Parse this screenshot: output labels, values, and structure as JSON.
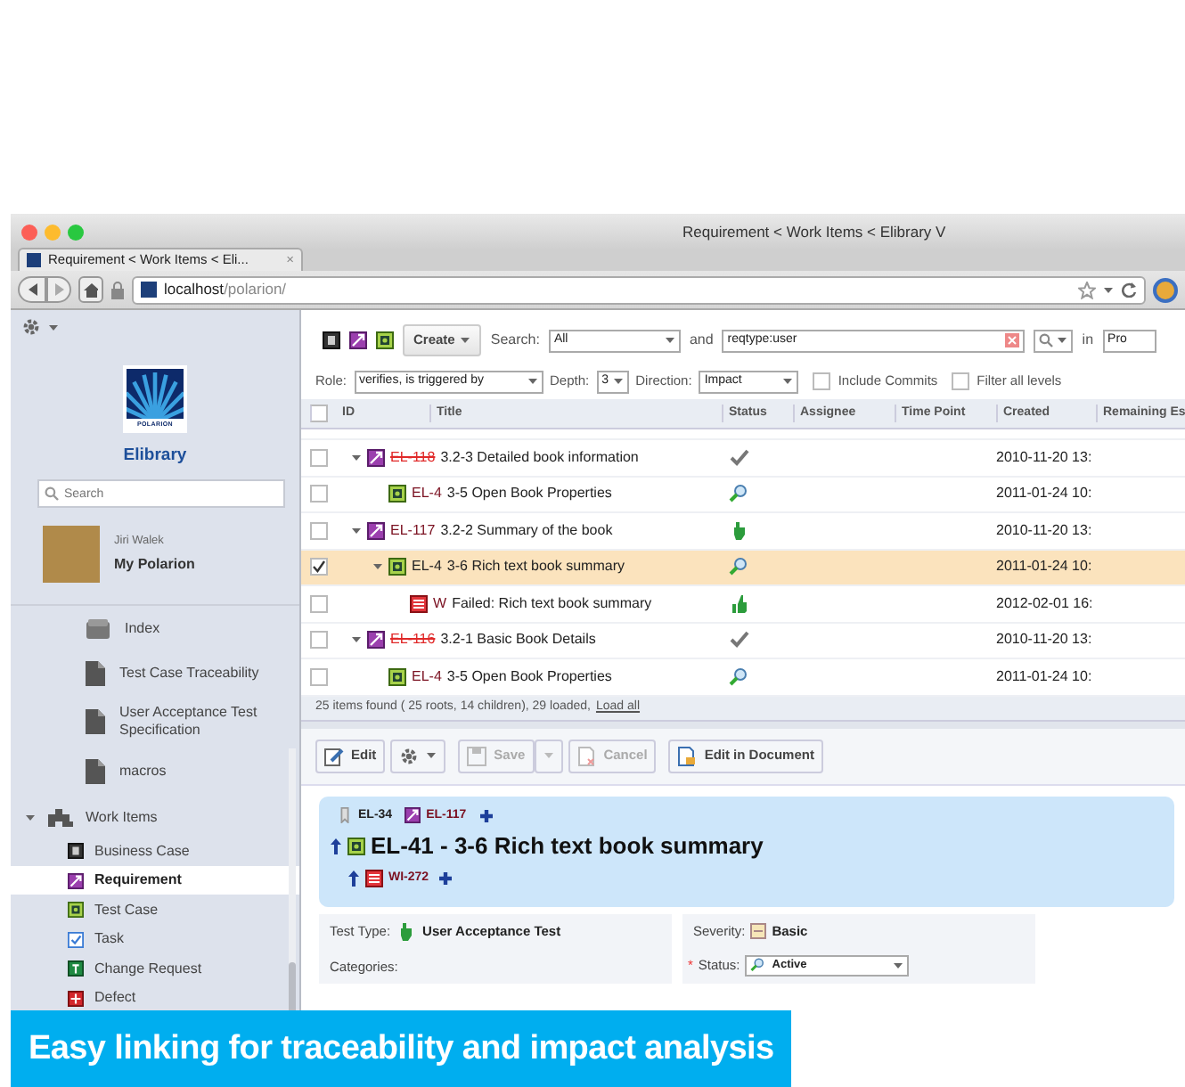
{
  "window": {
    "title": "Requirement < Work Items < Elibrary V"
  },
  "tab": {
    "label": "Requirement < Work Items < Eli...",
    "close": "×"
  },
  "address_bar": {
    "host": "localhost",
    "path": "/polarion/"
  },
  "sidebar": {
    "logo_text": "POLARION",
    "project": "Elibrary",
    "search": {
      "placeholder": "Search"
    },
    "user": {
      "name": "Jiri Walek",
      "link": "My Polarion"
    },
    "documents": [
      {
        "label": "Index",
        "kind": "folder"
      },
      {
        "label": "Test Case Traceability",
        "kind": "document"
      },
      {
        "label": "User Acceptance Test Specification",
        "kind": "document"
      },
      {
        "label": "macros",
        "kind": "document"
      }
    ],
    "section": {
      "label": "Work Items",
      "expanded": true,
      "items": [
        {
          "label": "Business Case",
          "kind": "business-case",
          "selected": false
        },
        {
          "label": "Requirement",
          "kind": "requirement",
          "selected": true
        },
        {
          "label": "Test Case",
          "kind": "test-case",
          "selected": false
        },
        {
          "label": "Task",
          "kind": "task",
          "selected": false
        },
        {
          "label": "Change Request",
          "kind": "change-request",
          "selected": false
        },
        {
          "label": "Defect",
          "kind": "defect",
          "selected": false
        }
      ]
    }
  },
  "toolbar": {
    "create": "Create",
    "search_label": "Search:",
    "search_scope": "All",
    "and": "and",
    "query": "reqtype:user",
    "in": "in",
    "in_value": "Pro"
  },
  "filters": {
    "role_label": "Role:",
    "role": "verifies, is triggered by",
    "depth_label": "Depth:",
    "depth": "3",
    "direction_label": "Direction:",
    "direction": "Impact",
    "include_commits": {
      "label": "Include Commits",
      "checked": false
    },
    "filter_all": {
      "label": "Filter all levels",
      "checked": false
    }
  },
  "table": {
    "select_all": {
      "checked": false
    },
    "columns": [
      "ID",
      "Title",
      "Status",
      "Assignee",
      "Time Point",
      "Created",
      "Remaining Es"
    ],
    "rows": [
      {
        "id": "EL-118",
        "title": "3.2-3 Detailed book information",
        "kind": "requirement",
        "color": "#e02828",
        "struck": true,
        "status": {
          "kind": "check"
        },
        "created": "2010-11-20 13:",
        "checked": false,
        "selected": false,
        "expanded": true,
        "children": [
          {
            "id": "EL-4",
            "title": "3-5 Open Book Properties",
            "kind": "test-case",
            "color": "#7a1020",
            "struck": false,
            "status": {
              "kind": "search"
            },
            "created": "2011-01-24 10:",
            "checked": false,
            "selected": false
          }
        ]
      },
      {
        "id": "EL-117",
        "title": "3.2-2 Summary of the book",
        "kind": "requirement",
        "color": "#7a1020",
        "struck": false,
        "status": {
          "kind": "hand"
        },
        "created": "2010-11-20 13:",
        "checked": false,
        "selected": false,
        "expanded": true,
        "children": [
          {
            "id": "EL-4",
            "title": "3-6 Rich text book summary",
            "kind": "test-case",
            "color": "#222222",
            "struck": false,
            "status": {
              "kind": "search"
            },
            "created": "2011-01-24 10:",
            "checked": true,
            "selected": true,
            "expanded": true,
            "children": [
              {
                "id": "W",
                "title": "Failed: Rich text book summary",
                "kind": "test-run",
                "color": "#7a1020",
                "struck": false,
                "status": {
                  "kind": "thumb"
                },
                "created": "2012-02-01 16:",
                "checked": false,
                "selected": false
              }
            ]
          }
        ]
      },
      {
        "id": "EL-116",
        "title": "3.2-1 Basic Book Details",
        "kind": "requirement",
        "color": "#e02828",
        "struck": true,
        "status": {
          "kind": "check"
        },
        "created": "2010-11-20 13:",
        "checked": false,
        "selected": false,
        "expanded": true,
        "children": [
          {
            "id": "EL-4",
            "title": "3-5 Open Book Properties",
            "kind": "test-case",
            "color": "#7a1020",
            "struck": false,
            "status": {
              "kind": "search"
            },
            "created": "2011-01-24 10:",
            "checked": false,
            "selected": false
          }
        ]
      }
    ]
  },
  "summary": {
    "text": "25 items found ( 25 roots, 14 children), 29 loaded,",
    "link": "Load all"
  },
  "detail_toolbar": [
    {
      "label": "Edit",
      "kind": "edit",
      "disabled": false
    },
    {
      "kind": "gear-menu"
    },
    {
      "label": "Save",
      "kind": "save",
      "disabled": true
    },
    {
      "kind": "caret",
      "disabled": true
    },
    {
      "label": "Cancel",
      "kind": "cancel",
      "disabled": true
    },
    {
      "label": "Edit in Document",
      "kind": "document",
      "disabled": false
    }
  ],
  "detail": {
    "parents": [
      {
        "id": "EL-34",
        "kind": "bookmark"
      },
      {
        "id": "EL-117",
        "kind": "requirement"
      }
    ],
    "title": "EL-41 - 3-6 Rich text book summary",
    "kind": "test-case",
    "children": [
      {
        "id": "WI-272",
        "kind": "test-run"
      }
    ]
  },
  "fields": {
    "left": [
      {
        "label": "Test Type:",
        "value": "User Acceptance Test"
      },
      {
        "label": "Categories:"
      }
    ],
    "right": [
      {
        "label": "Severity:",
        "value": "Basic"
      },
      {
        "label": "Status:",
        "value": "Active",
        "kind": "select",
        "required_mark": "*"
      }
    ]
  },
  "caption": "Easy linking for traceability and impact analysis"
}
